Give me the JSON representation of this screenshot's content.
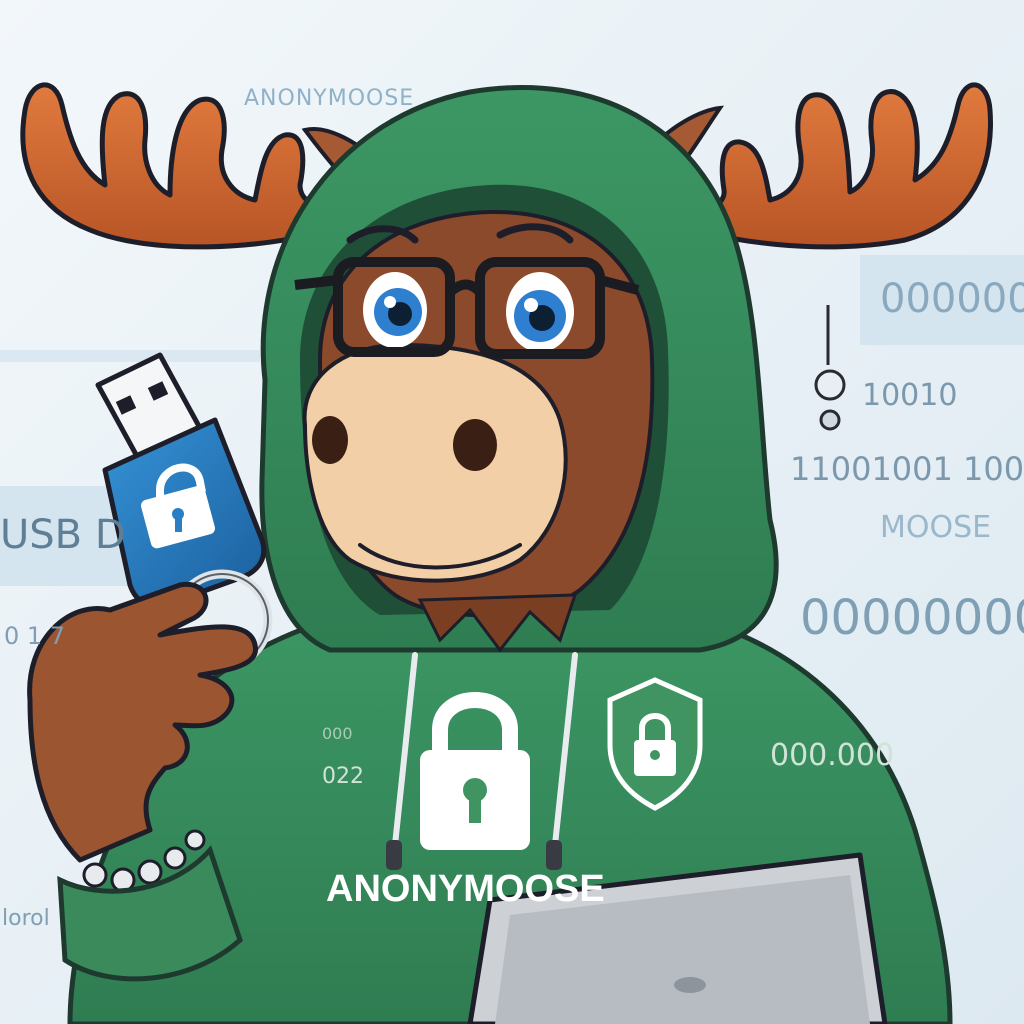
{
  "background_texts": {
    "header_word": "ANONYMOOSE",
    "binary_right_1": "000000",
    "binary_right_2": "10010",
    "binary_right_3": "11001001 100",
    "moose_right": "MOOSE",
    "zeros_right": "00000000",
    "left_label": "USB D",
    "sleeve_bottom_left": "lorol",
    "dots_right": "000.000",
    "misc_left_digits": "0 1 7"
  },
  "character": {
    "hoodie_print": "ANONYMOOSE",
    "hoodie_small_text": "022",
    "hoodie_small_text_2": "000"
  },
  "colors": {
    "background": "#e9f1f6",
    "hoodie_green": "#3f9461",
    "antler_orange": "#d9733a",
    "fur_brown": "#8b4a2b",
    "muzzle_tan": "#f2cfa6",
    "usb_blue": "#2a7ec4",
    "laptop_gray": "#c9cdd3"
  },
  "icons": [
    "lock-icon",
    "shield-lock-icon",
    "usb-drive-icon",
    "laptop-icon"
  ]
}
